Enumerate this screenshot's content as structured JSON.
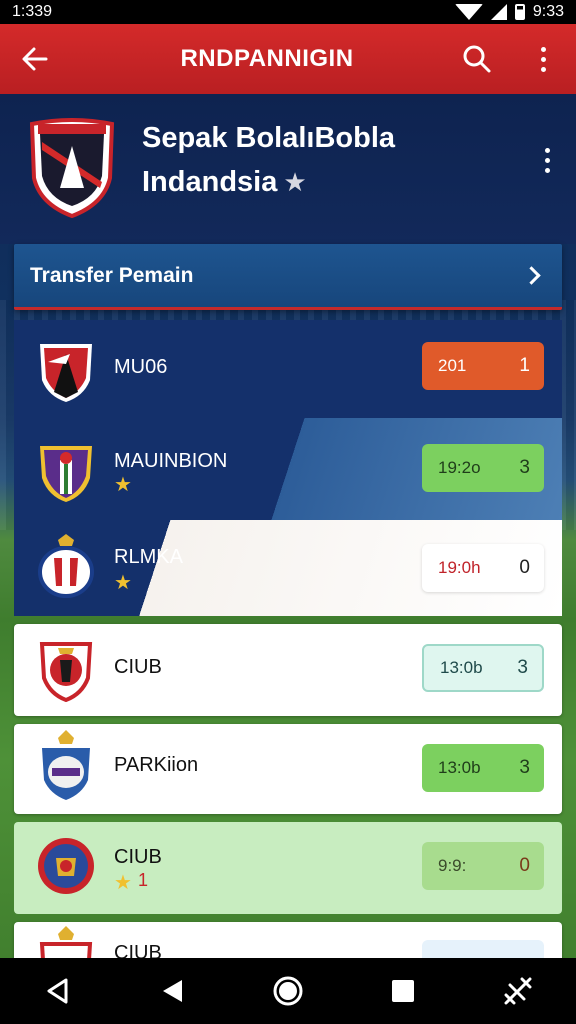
{
  "status_bar": {
    "time_left": "1:339",
    "time_right": "9:33"
  },
  "app_bar": {
    "title": "RNDPANNIGIN"
  },
  "header": {
    "club_name_line1": "Sepak BolalıBobla",
    "club_name_line2": "Indandsia"
  },
  "banner": {
    "label": "Transfer Pemain"
  },
  "rows": [
    {
      "name": "MU06",
      "score_left": "201",
      "score_right": "1",
      "score_color": "#e05a2a",
      "text_color": "#ffffff",
      "star": false
    },
    {
      "name": "MAUINBION",
      "score_left": "19:2o",
      "score_right": "3",
      "score_color": "#7cd05f",
      "text_color": "#1f3d1a",
      "star": true
    },
    {
      "name": "RLMKA",
      "score_left": "19:0h",
      "score_right": "0",
      "score_color": "#ffffff",
      "text_color": "#c0232a",
      "star": true
    },
    {
      "name": "CIUB",
      "score_left": "13:0b",
      "score_right": "3",
      "score_color": "#dff6ef",
      "text_color": "#1f4a4a",
      "star": false
    },
    {
      "name": "PARKiion",
      "score_left": "13:0b",
      "score_right": "3",
      "score_color": "#7cd05f",
      "text_color": "#1f3d1a",
      "star": false
    },
    {
      "name": "CIUB",
      "score_left": "9:9:",
      "score_right": "0",
      "score_color": "#a8dc8e",
      "text_color": "#3a4a2a",
      "star": true,
      "star_suffix": "1"
    },
    {
      "name": "CIUB",
      "score_left": "",
      "score_right": "",
      "score_color": "#e6f2fb",
      "text_color": "#333333",
      "star": false
    }
  ],
  "icons": {
    "back": "arrow-left-icon",
    "search": "search-icon",
    "more": "more-vertical-icon",
    "chevron": "chevron-right-icon",
    "nav": [
      "back-triangle-icon",
      "play-left-icon",
      "home-circle-icon",
      "recents-square-icon",
      "rotate-icon"
    ]
  },
  "colors": {
    "app_bar": "#c8242a",
    "header_bg": "#0e2350",
    "banner_bg": "#1e5590"
  }
}
